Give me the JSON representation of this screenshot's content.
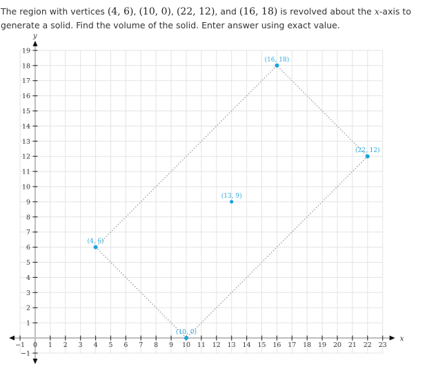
{
  "question": {
    "part1": "The region with vertices ",
    "v1": "(4, 6)",
    "sep1": ", ",
    "v2": "(10, 0)",
    "sep2": ", ",
    "v3": "(22, 12)",
    "sep3": ", and ",
    "v4": "(16, 18)",
    "part2": " is revolved about the ",
    "axis_var": "x",
    "part3": "-axis to generate a solid. Find the volume of the solid. Enter answer using exact value."
  },
  "chart_data": {
    "type": "scatter",
    "title": "",
    "xlabel": "x",
    "ylabel": "y",
    "xlim": [
      -1,
      23
    ],
    "ylim": [
      -1,
      19
    ],
    "grid": true,
    "x_ticks": [
      -1,
      0,
      1,
      2,
      3,
      4,
      5,
      6,
      7,
      8,
      9,
      10,
      11,
      12,
      13,
      14,
      15,
      16,
      17,
      18,
      19,
      20,
      21,
      22,
      23
    ],
    "y_ticks": [
      -1,
      1,
      2,
      3,
      4,
      5,
      6,
      7,
      8,
      9,
      10,
      11,
      12,
      13,
      14,
      15,
      16,
      17,
      18,
      19
    ],
    "polygon": {
      "style": "dotted",
      "vertices": [
        [
          4,
          6
        ],
        [
          10,
          0
        ],
        [
          22,
          12
        ],
        [
          16,
          18
        ]
      ]
    },
    "points": [
      {
        "x": 4,
        "y": 6,
        "label": "(4, 6)",
        "label_pos": "above"
      },
      {
        "x": 10,
        "y": 0,
        "label": "(10, 0)",
        "label_pos": "above"
      },
      {
        "x": 22,
        "y": 12,
        "label": "(22, 12)",
        "label_pos": "above"
      },
      {
        "x": 16,
        "y": 18,
        "label": "(16, 18)",
        "label_pos": "above"
      },
      {
        "x": 13,
        "y": 9,
        "label": "(13, 9)",
        "label_pos": "above",
        "small": true
      }
    ],
    "colors": {
      "point": "#1aa3e0",
      "label": "#2aa7d8",
      "grid": "#e3e3e3",
      "axis": "#bdbdbd",
      "polygon": "#aaaaaa"
    }
  }
}
